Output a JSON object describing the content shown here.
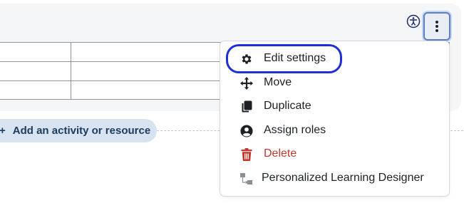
{
  "menu": {
    "items": [
      {
        "label": "Edit settings",
        "icon": "gear-icon"
      },
      {
        "label": "Move",
        "icon": "move-arrows-icon"
      },
      {
        "label": "Duplicate",
        "icon": "copy-icon"
      },
      {
        "label": "Assign roles",
        "icon": "user-circle-icon"
      },
      {
        "label": "Delete",
        "icon": "trash-icon"
      },
      {
        "label": "Personalized Learning Designer",
        "icon": "pld-icon"
      }
    ]
  },
  "add_activity": {
    "plus": "+",
    "label": "Add an activity or resource"
  },
  "colors": {
    "accent": "#1f2fd6",
    "danger": "#c0392b",
    "pill": "#d7e3f0"
  }
}
